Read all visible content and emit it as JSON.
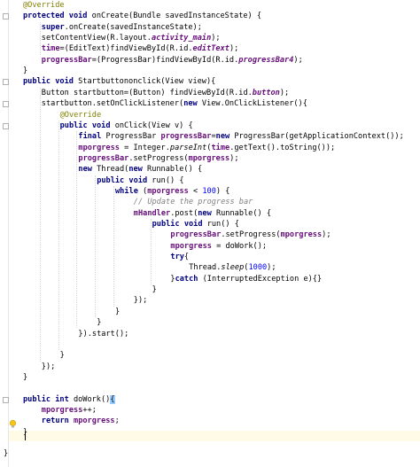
{
  "editor": {
    "lines": [
      {
        "i": 0,
        "text": "@Override"
      },
      {
        "i": 0,
        "text": "protected void onCreate(Bundle savedInstanceState) {"
      },
      {
        "i": 4,
        "text": "super.onCreate(savedInstanceState);"
      },
      {
        "i": 4,
        "text": "setContentView(R.layout.activity_main);"
      },
      {
        "i": 4,
        "text": "time=(EditText)findViewById(R.id.editText);"
      },
      {
        "i": 4,
        "text": "progressBar=(ProgressBar)findViewById(R.id.progressBar4);"
      },
      {
        "i": 0,
        "text": "}"
      },
      {
        "i": 0,
        "text": "public void Startbuttononclick(View view){"
      },
      {
        "i": 4,
        "text": "Button startbutton=(Button) findViewById(R.id.button);"
      },
      {
        "i": 4,
        "text": "startbutton.setOnClickListener(new View.OnClickListener(){"
      },
      {
        "i": 8,
        "text": "@Override"
      },
      {
        "i": 8,
        "text": "public void onClick(View v) {"
      },
      {
        "i": 12,
        "text": "final ProgressBar progressBar=new ProgressBar(getApplicationContext());"
      },
      {
        "i": 12,
        "text": "mporgress = Integer.parseInt(time.getText().toString());"
      },
      {
        "i": 12,
        "text": "progressBar.setProgress(mporgress);"
      },
      {
        "i": 12,
        "text": "new Thread(new Runnable() {"
      },
      {
        "i": 16,
        "text": "public void run() {"
      },
      {
        "i": 20,
        "text": "while (mporgress < 100) {"
      },
      {
        "i": 24,
        "text": "// Update the progress bar"
      },
      {
        "i": 24,
        "text": "mHandler.post(new Runnable() {"
      },
      {
        "i": 28,
        "text": "public void run() {"
      },
      {
        "i": 32,
        "text": "progressBar.setProgress(mporgress);"
      },
      {
        "i": 32,
        "text": "mporgress = doWork();"
      },
      {
        "i": 32,
        "text": "try{"
      },
      {
        "i": 36,
        "text": "Thread.sleep(1000);"
      },
      {
        "i": 32,
        "text": "}catch (InterruptedException e){}"
      },
      {
        "i": 28,
        "text": "}"
      },
      {
        "i": 24,
        "text": "});"
      },
      {
        "i": 20,
        "text": "}"
      },
      {
        "i": 16,
        "text": "}"
      },
      {
        "i": 12,
        "text": "}).start();"
      },
      {
        "i": 0,
        "text": ""
      },
      {
        "i": 8,
        "text": "}"
      },
      {
        "i": 4,
        "text": "});"
      },
      {
        "i": 0,
        "text": "}"
      },
      {
        "i": 0,
        "text": ""
      },
      {
        "i": 0,
        "text": "public int doWork(){"
      },
      {
        "i": 4,
        "text": "mporgress++;"
      },
      {
        "i": 4,
        "text": "return mporgress;"
      },
      {
        "i": 0,
        "text": "}"
      },
      {
        "i": 0,
        "text": ""
      },
      {
        "i": 0,
        "text": "}"
      }
    ]
  },
  "colors": {
    "keyword": "#000080",
    "annotation": "#808000",
    "field": "#660e7a",
    "number": "#0000ff",
    "comment": "#808080",
    "caret_line": "#fffbe6"
  }
}
